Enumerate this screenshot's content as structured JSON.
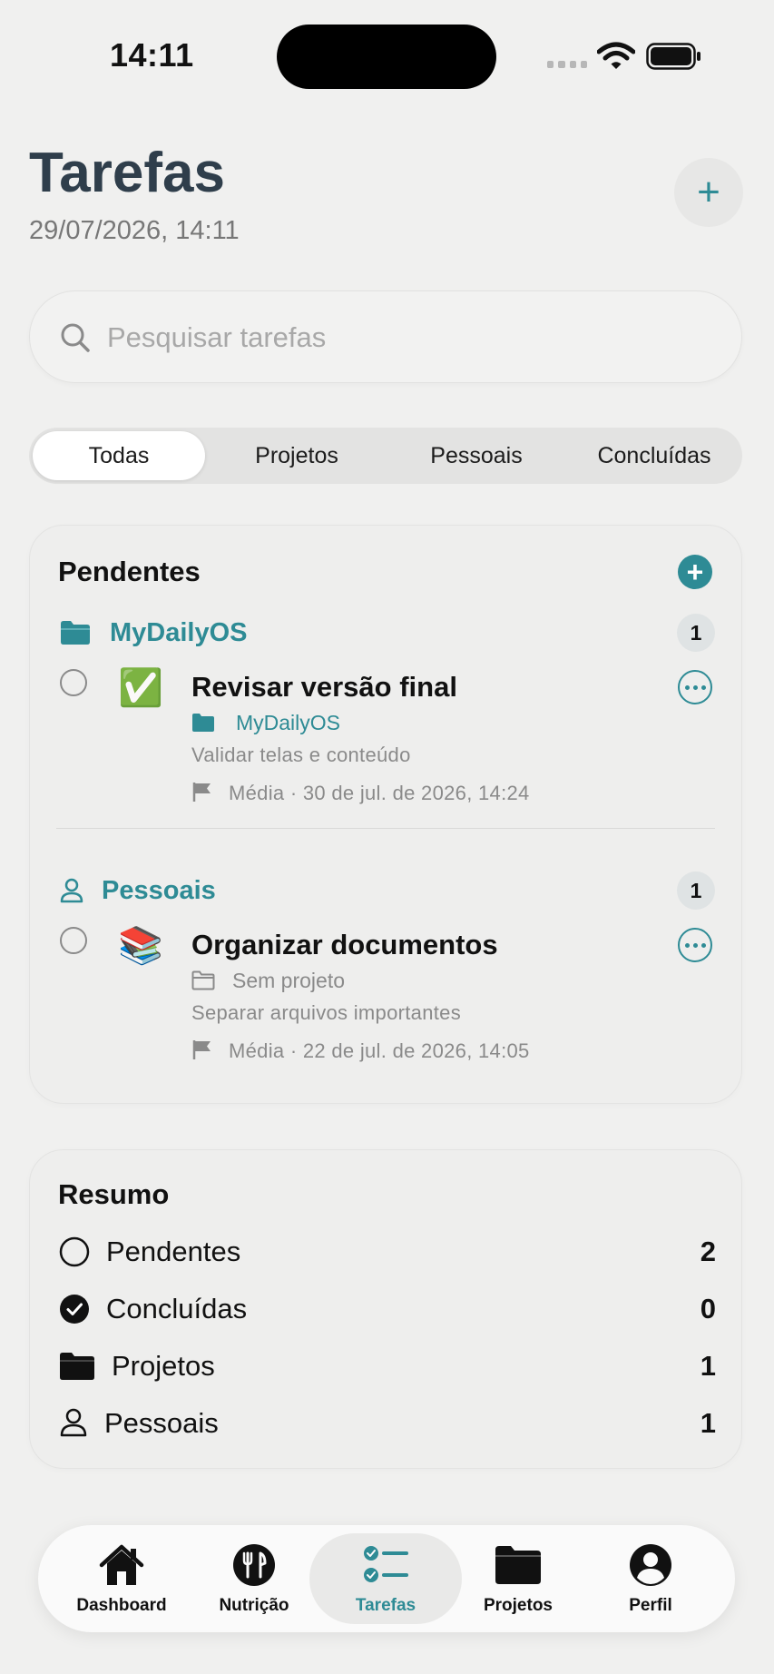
{
  "status_bar": {
    "time": "14:11"
  },
  "header": {
    "title": "Tarefas",
    "datetime": "29/07/2026, 14:11"
  },
  "search": {
    "placeholder": "Pesquisar tarefas",
    "value": ""
  },
  "filters": {
    "selected": "Todas",
    "options": [
      "Todas",
      "Projetos",
      "Pessoais",
      "Concluídas"
    ]
  },
  "pending": {
    "title": "Pendentes",
    "groups": [
      {
        "label": "MyDailyOS",
        "icon": "folder-icon",
        "count": "1",
        "task": {
          "emoji": "✅",
          "title": "Revisar versão final",
          "project": "MyDailyOS",
          "description": "Validar telas e conteúdo",
          "meta": "Média · 30 de jul. de 2026, 14:24"
        }
      },
      {
        "label": "Pessoais",
        "icon": "person-icon",
        "count": "1",
        "task": {
          "emoji": "📚",
          "title": "Organizar documentos",
          "project": "Sem projeto",
          "description": "Separar arquivos importantes",
          "meta": "Média · 22 de jul. de 2026, 14:05"
        }
      }
    ]
  },
  "summary": {
    "title": "Resumo",
    "rows": [
      {
        "label": "Pendentes",
        "value": "2",
        "icon": "circle-icon"
      },
      {
        "label": "Concluídas",
        "value": "0",
        "icon": "checkmark-circle-icon"
      },
      {
        "label": "Projetos",
        "value": "1",
        "icon": "folder-icon"
      },
      {
        "label": "Pessoais",
        "value": "1",
        "icon": "person-icon"
      }
    ]
  },
  "tab_bar": {
    "active": "Tarefas",
    "items": [
      {
        "label": "Dashboard",
        "icon": "house-icon"
      },
      {
        "label": "Nutrição",
        "icon": "fork-knife-icon"
      },
      {
        "label": "Tarefas",
        "icon": "checklist-icon"
      },
      {
        "label": "Projetos",
        "icon": "folder-icon"
      },
      {
        "label": "Perfil",
        "icon": "person-circle-icon"
      }
    ]
  },
  "colors": {
    "accent": "#2e8b95",
    "title": "#2f3e4b",
    "background": "#f0f0ef"
  }
}
